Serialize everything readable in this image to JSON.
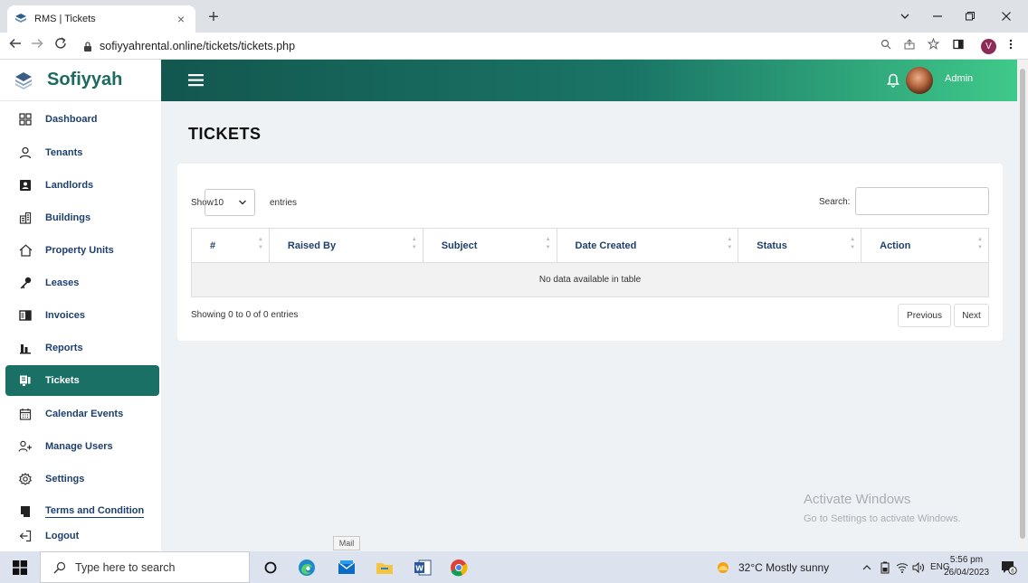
{
  "browser": {
    "tab_title": "RMS | Tickets",
    "tab_close": "×",
    "new_tab": "+",
    "url": "sofiyyahrental.online/tickets/tickets.php",
    "profile_initial": "V"
  },
  "header": {
    "brand_name": "Sofiyyah",
    "user_name": "Admin"
  },
  "sidebar": {
    "items": [
      {
        "label": "Dashboard",
        "icon": "grid-icon"
      },
      {
        "label": "Tenants",
        "icon": "person-icon"
      },
      {
        "label": "Landlords",
        "icon": "id-card-icon"
      },
      {
        "label": "Buildings",
        "icon": "building-icon"
      },
      {
        "label": "Property Units",
        "icon": "home-icon"
      },
      {
        "label": "Leases",
        "icon": "key-icon"
      },
      {
        "label": "Invoices",
        "icon": "invoice-icon"
      },
      {
        "label": "Reports",
        "icon": "bar-chart-icon"
      },
      {
        "label": "Tickets",
        "icon": "ticket-icon",
        "active": true
      },
      {
        "label": "Calendar Events",
        "icon": "calendar-icon"
      },
      {
        "label": "Manage Users",
        "icon": "add-user-icon"
      },
      {
        "label": "Settings",
        "icon": "gear-icon"
      },
      {
        "label": "Terms and Condition",
        "icon": "book-icon"
      },
      {
        "label": "Logout",
        "icon": "logout-icon"
      }
    ]
  },
  "main": {
    "page_title": "TICKETS",
    "show_label": "Show",
    "page_length": "10",
    "entries_label": "entries",
    "search_label": "Search:",
    "columns": [
      "#",
      "Raised By",
      "Subject",
      "Date Created",
      "Status",
      "Action"
    ],
    "empty_message": "No data available in table",
    "info": "Showing 0 to 0 of 0 entries",
    "prev_label": "Previous",
    "next_label": "Next"
  },
  "watermark": {
    "line1": "Activate Windows",
    "line2": "Go to Settings to activate Windows."
  },
  "tooltip": "Mail",
  "taskbar": {
    "search_placeholder": "Type here to search",
    "weather": "32°C  Mostly sunny",
    "language": "ENG",
    "time": "5:56 pm",
    "date": "26/04/2023",
    "notification_count": "6"
  },
  "colors": {
    "brand": "#1d6b5f",
    "active_nav": "#1a7064",
    "nav_text": "#1d3f6e",
    "header_gradient_start": "#13574f",
    "header_gradient_end": "#3fc98a"
  }
}
